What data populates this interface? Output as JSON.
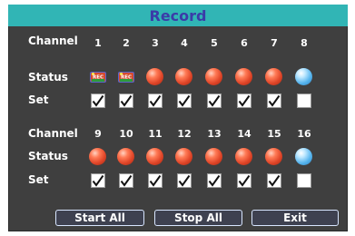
{
  "title": "Record",
  "labels": {
    "channel": "Channel",
    "status": "Status",
    "set": "Set"
  },
  "group1": {
    "channels": [
      "1",
      "2",
      "3",
      "4",
      "5",
      "6",
      "7",
      "8"
    ],
    "status": [
      "recording-icon",
      "recording-icon",
      "red-ball-icon",
      "red-ball-icon",
      "red-ball-icon",
      "red-ball-icon",
      "red-ball-icon",
      "blue-ball-icon"
    ],
    "set": [
      true,
      true,
      true,
      true,
      true,
      true,
      true,
      false
    ]
  },
  "group2": {
    "channels": [
      "9",
      "10",
      "11",
      "12",
      "13",
      "14",
      "15",
      "16"
    ],
    "status": [
      "red-ball-icon",
      "red-ball-icon",
      "red-ball-icon",
      "red-ball-icon",
      "red-ball-icon",
      "red-ball-icon",
      "red-ball-icon",
      "blue-ball-icon"
    ],
    "set": [
      true,
      true,
      true,
      true,
      true,
      true,
      true,
      false
    ]
  },
  "buttons": {
    "start_all": "Start All",
    "stop_all": "Stop All",
    "exit": "Exit"
  },
  "colors": {
    "title_bar": "#31b5b5",
    "title_text": "#3b3ba8",
    "panel": "#3f3f3f"
  }
}
